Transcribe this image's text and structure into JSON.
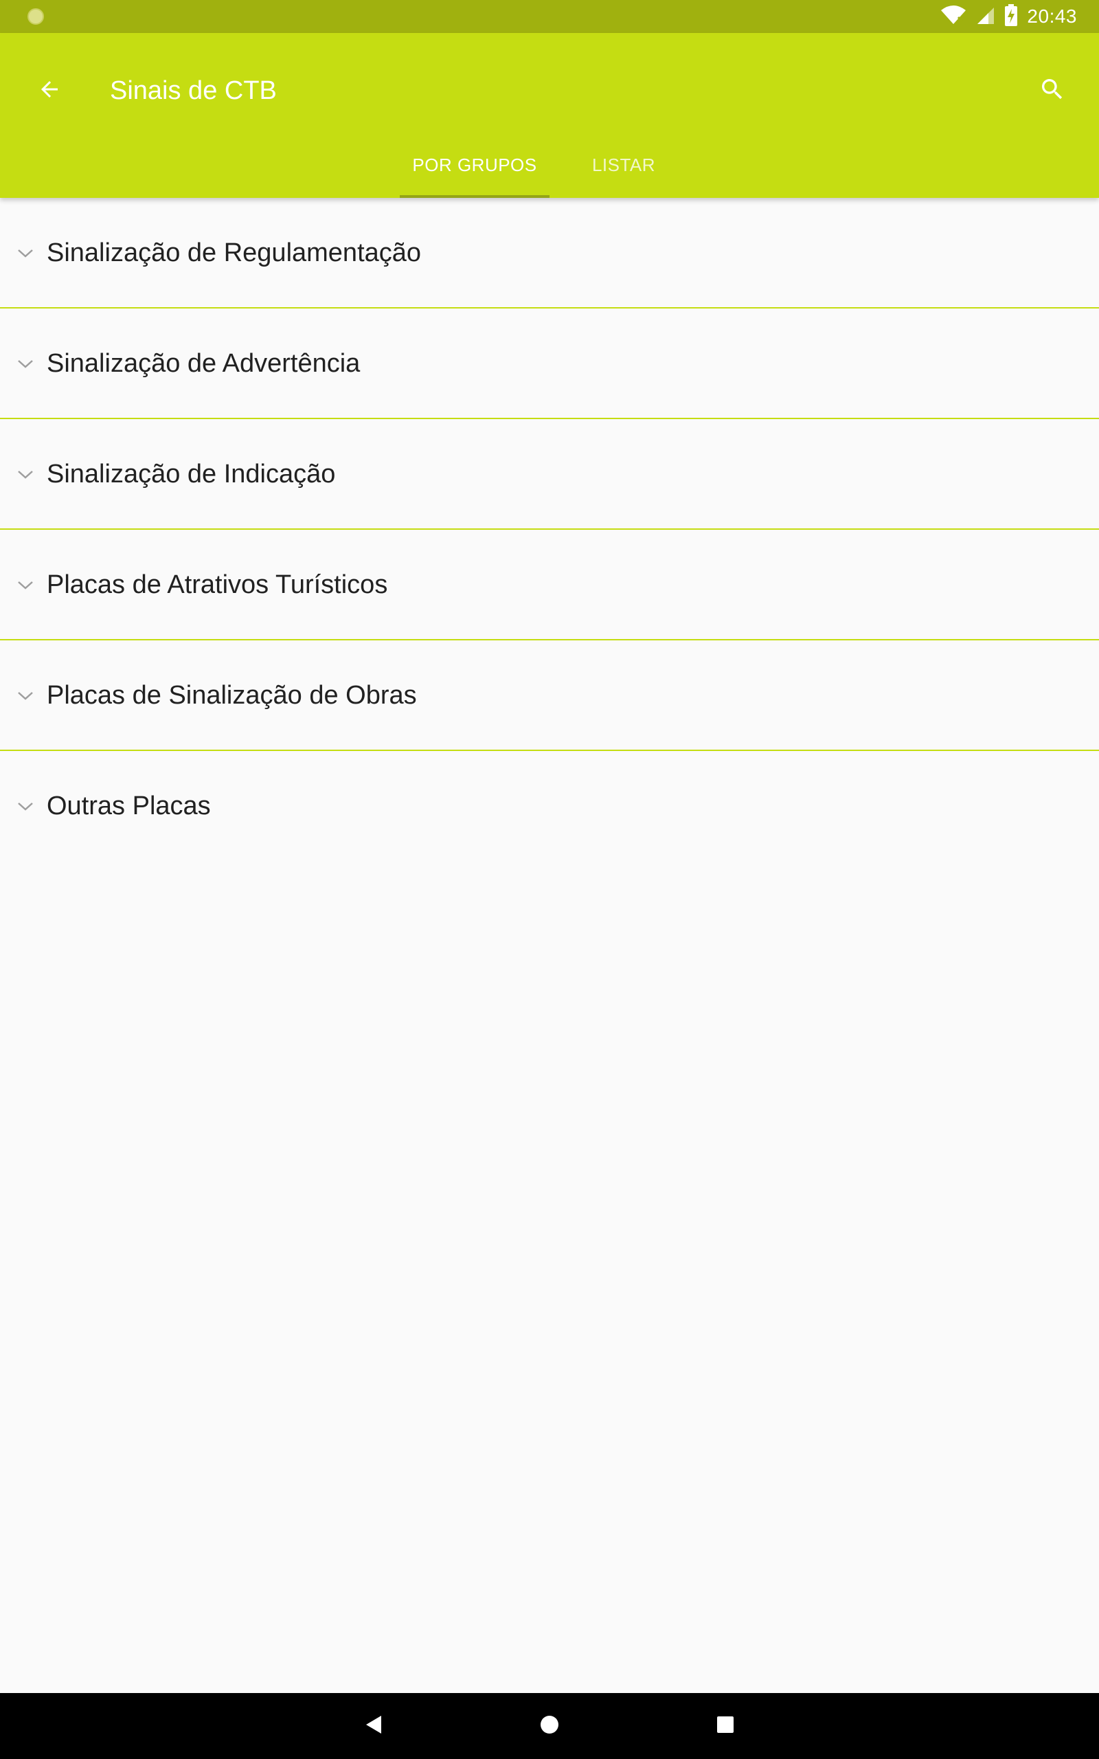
{
  "status_bar": {
    "time": "20:43",
    "icons": [
      "notification-dot-icon",
      "wifi-icon",
      "signal-icon",
      "battery-charging-icon"
    ]
  },
  "app_bar": {
    "title": "Sinais de CTB",
    "back_icon": "arrow-back-icon",
    "search_icon": "search-icon",
    "background_color": "#c5dd12"
  },
  "tabs": [
    {
      "label": "POR GRUPOS",
      "selected": true
    },
    {
      "label": "LISTAR",
      "selected": false
    }
  ],
  "groups": [
    {
      "label": "Sinalização de Regulamentação",
      "expanded": false
    },
    {
      "label": "Sinalização de Advertência",
      "expanded": false
    },
    {
      "label": "Sinalização de Indicação",
      "expanded": false
    },
    {
      "label": "Placas de Atrativos Turísticos",
      "expanded": false
    },
    {
      "label": "Placas de Sinalização de Obras",
      "expanded": false
    },
    {
      "label": "Outras Placas",
      "expanded": false
    }
  ],
  "nav_bar": {
    "buttons": [
      "nav-back-icon",
      "nav-home-icon",
      "nav-recents-icon"
    ]
  }
}
